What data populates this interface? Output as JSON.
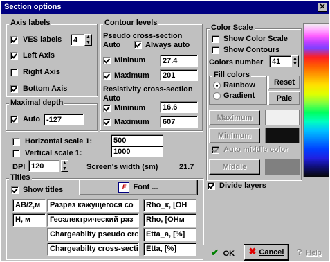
{
  "window": {
    "title": "Section options",
    "close_glyph": "✕"
  },
  "axis_labels": {
    "caption": "Axis labels",
    "ves_label": "VES labels",
    "ves_value": "4",
    "left_axis": "Left Axis",
    "right_axis": "Right Axis",
    "bottom_axis": "Bottom Axis",
    "ves_checked": true,
    "left_checked": true,
    "right_checked": false,
    "bottom_checked": true
  },
  "maximal_depth": {
    "caption": "Maximal depth",
    "auto_label": "Auto",
    "auto_checked": true,
    "value": "-127"
  },
  "contour_levels": {
    "caption": "Contour levels",
    "pseudo_caption": "Pseudo cross-section",
    "auto_text": "Auto",
    "always_auto": "Always auto",
    "always_auto_checked": true,
    "pseudo_min_label": "Mininum",
    "pseudo_min_value": "27.4",
    "pseudo_max_label": "Maximum",
    "pseudo_max_value": "201",
    "resist_caption": "Resistivity cross-section",
    "resist_auto_text": "Auto",
    "resist_min_label": "Mininum",
    "resist_min_value": "16.6",
    "resist_max_label": "Maximum",
    "resist_max_value": "607"
  },
  "scales": {
    "horizontal_label": "Horizontal scale 1:",
    "horizontal_value": "500",
    "vertical_label": "Vertical scale 1:",
    "vertical_value": "1000",
    "dpi_label": "DPI",
    "dpi_value": "120",
    "screen_width_label": "Screen's width (sm)",
    "screen_width_value": "21.7"
  },
  "color_scale": {
    "caption": "Color Scale",
    "show_color_scale": "Show Color Scale",
    "show_contours": "Show Contours",
    "colors_number_label": "Colors number",
    "colors_number_value": "41",
    "fill_caption": "Fill colors",
    "rainbow": "Rainbow",
    "gradient": "Gradient",
    "reset_button": "Reset",
    "pale_button": "Pale",
    "maximum_button": "Maximum",
    "minimum_button": "Minimum",
    "auto_middle": "Auto middle color",
    "middle_button": "Middle",
    "max_color": "#f0f0f0",
    "min_color": "#101010",
    "mid_color": "#808080"
  },
  "divide_layers": {
    "label": "Divide layers",
    "checked": true
  },
  "titles": {
    "caption": "Titles",
    "show_titles": "Show titles",
    "font_button": "Font ...",
    "rows": [
      [
        "AB/2,м",
        "Разрез кажущегося со",
        "Rho_к, [OH"
      ],
      [
        "H, м",
        "Геоэлектрический раз",
        "Rho, [OHм"
      ],
      [
        "",
        "Chargeabilty pseudo cro",
        "Etta_a, [%]"
      ],
      [
        "",
        "Chargeabilty cross-secti",
        "Etta, [%]"
      ]
    ]
  },
  "footer": {
    "ok": "OK",
    "cancel": "Cancel",
    "help": "Help"
  }
}
